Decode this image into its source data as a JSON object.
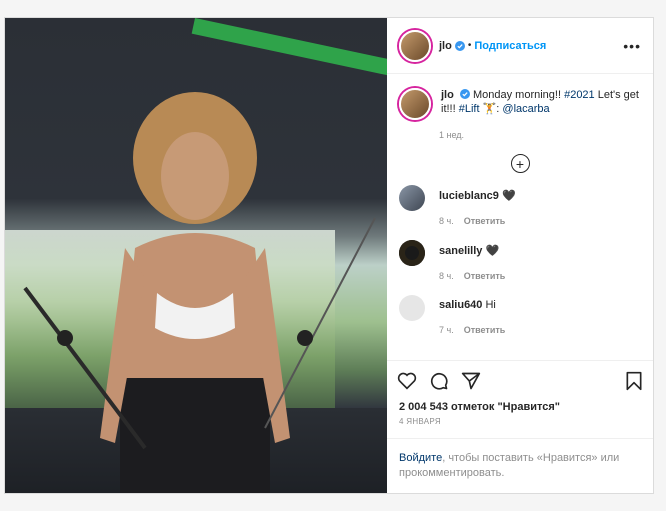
{
  "post": {
    "username": "jlo",
    "dot": "•",
    "follow_label": "Подписаться",
    "more_label": "•••",
    "caption": {
      "username": "jlo",
      "text": "Monday morning!! ",
      "hashtag1": "#2021",
      "text2": " Let's get it!!! ",
      "hashtag2": "#Lift",
      "emoji": " 🏋️: ",
      "mention": "@lacarba"
    },
    "caption_time": "1 нед.",
    "expand_icon": "plus-circle-icon",
    "comments": [
      {
        "username": "lucieblanc9",
        "text": "🖤",
        "time": "8 ч.",
        "reply": "Ответить",
        "avatar_color": "#6f7b8c"
      },
      {
        "username": "sanelilly",
        "text": "🖤",
        "time": "8 ч.",
        "reply": "Ответить",
        "avatar_color": "#1a1a1a"
      },
      {
        "username": "saliu640",
        "text": "Hi",
        "time": "7 ч.",
        "reply": "Ответить",
        "avatar_color": "#e6e6e6"
      }
    ],
    "likes": "2 004 543 отметок \"Нравится\"",
    "date": "4 ЯНВАРЯ",
    "login_link": "Войдите",
    "login_text": ", чтобы поставить «Нравится» или прокомментировать."
  },
  "colors": {
    "accent": "#0095f6",
    "link": "#00376b",
    "text": "#262626",
    "muted": "#8e8e8e"
  }
}
